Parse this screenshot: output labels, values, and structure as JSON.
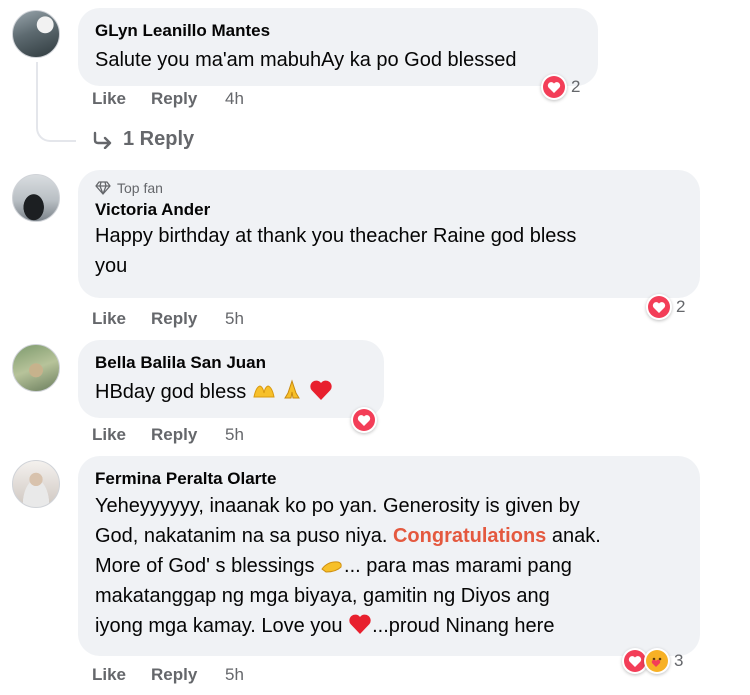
{
  "comments": [
    {
      "name": "GLyn Leanillo Mantes",
      "text": "Salute you ma'am mabuhAy ka po God blessed",
      "like": "Like",
      "reply": "Reply",
      "time": "4h",
      "reaction_count": "2",
      "replies_link": "1 Reply"
    },
    {
      "badge": "Top fan",
      "name": "Victoria Ander",
      "text_line1": "Happy birthday at thank you theacher Raine god bless",
      "text_line2": "you",
      "like": "Like",
      "reply": "Reply",
      "time": "5h",
      "reaction_count": "2"
    },
    {
      "name": "Bella Balila San Juan",
      "text": "HBday god bless",
      "like": "Like",
      "reply": "Reply",
      "time": "5h"
    },
    {
      "name": "Fermina Peralta Olarte",
      "line1": "Yeheyyyyyy, inaanak ko po yan. Generosity is given by",
      "line2_a": "God, nakatanim na sa puso niya.",
      "line2_highlight": "Congratulations",
      "line2_b": "anak.",
      "line3_a": "More of God' s blessings",
      "line3_b": "... para mas marami pang",
      "line4": "makatanggap ng mga biyaya, gamitin ng Diyos ang",
      "line5_a": "iyong mga kamay. Love you",
      "line5_b": "...proud Ninang here",
      "like": "Like",
      "reply": "Reply",
      "time": "5h",
      "reaction_count": "3"
    }
  ],
  "colors": {
    "bubble": "#f0f2f5",
    "secondary_text": "#65676b",
    "love": "#f33e58",
    "care": "#f7b125",
    "highlight": "#e4593f"
  }
}
